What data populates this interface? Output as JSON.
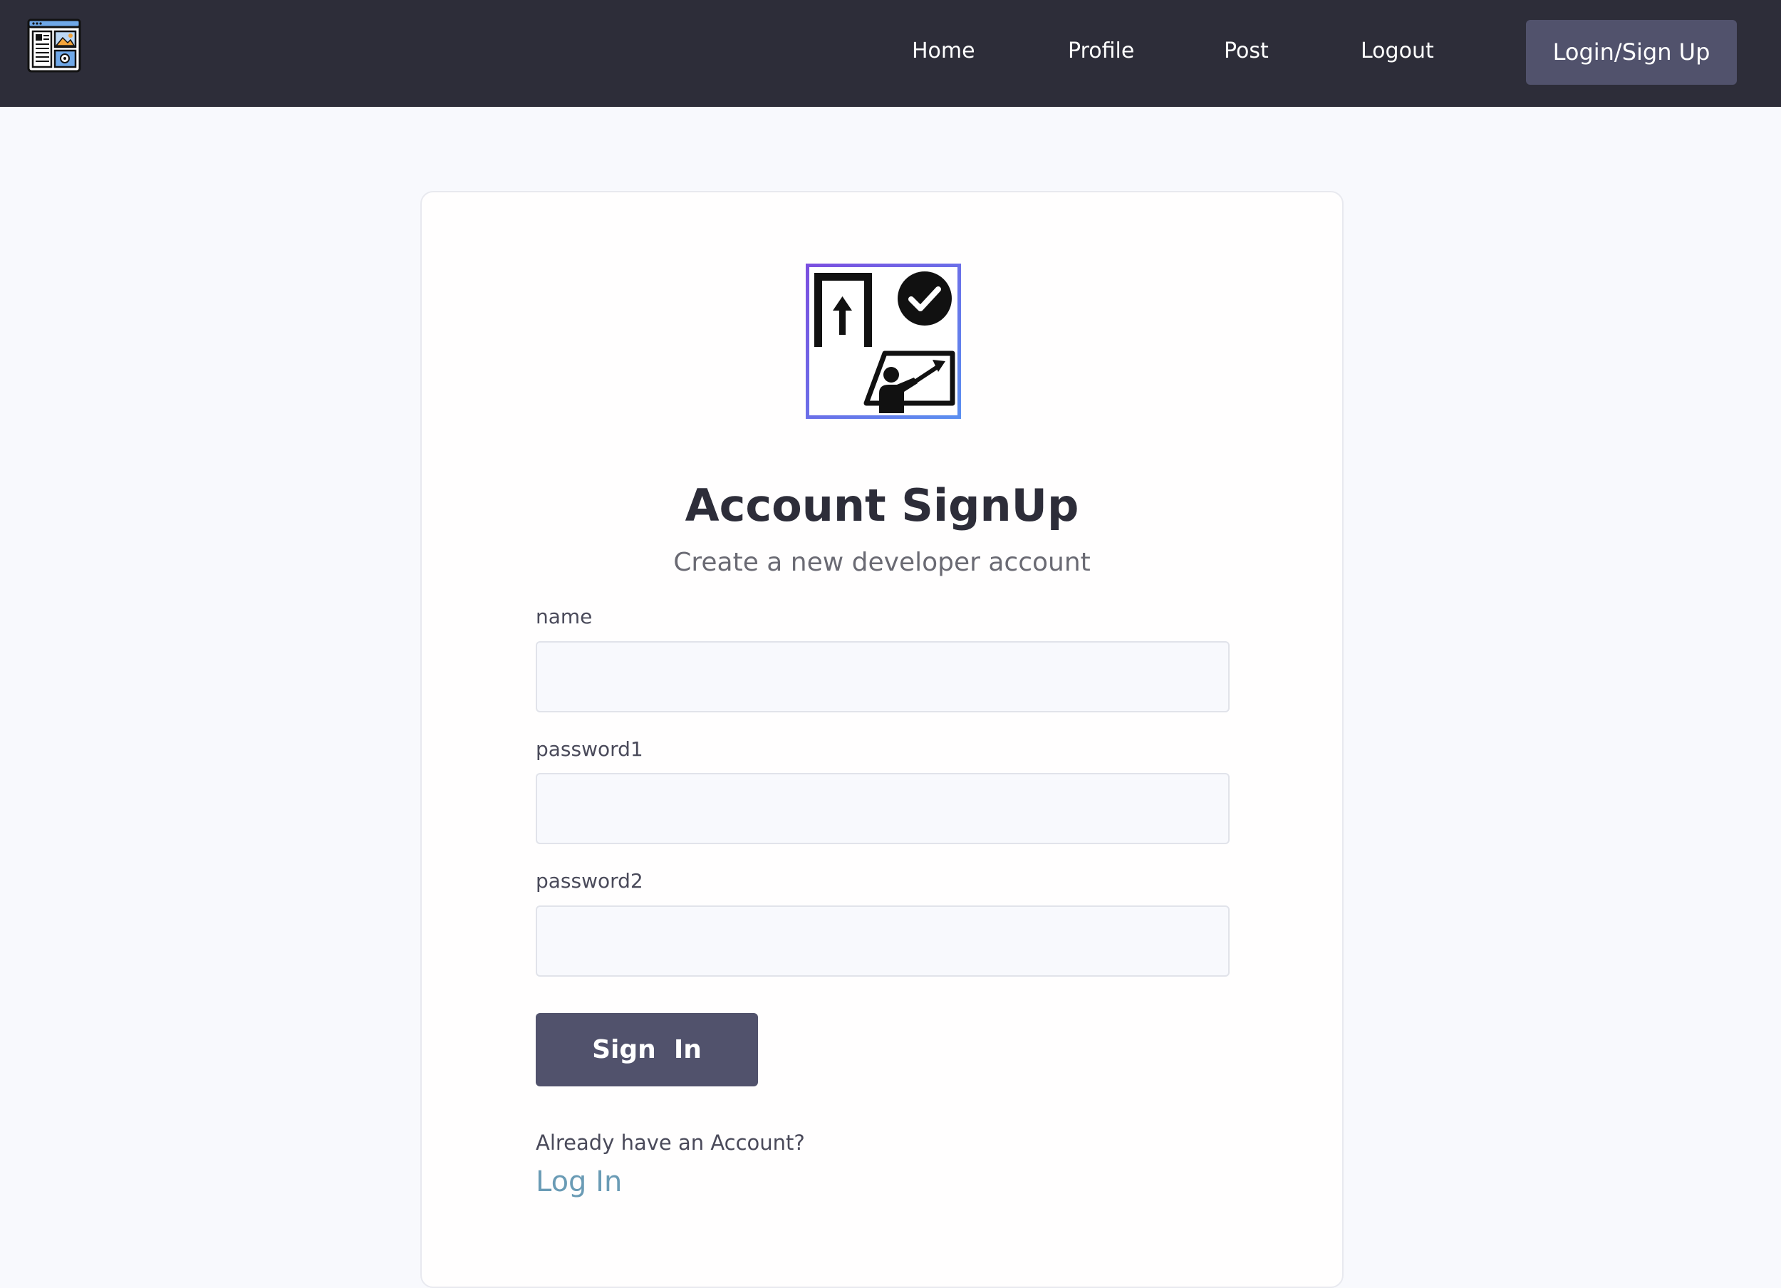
{
  "navbar": {
    "logo_icon": "newspaper-layout-icon",
    "links": [
      {
        "label": "Home"
      },
      {
        "label": "Profile"
      },
      {
        "label": "Post"
      },
      {
        "label": "Logout"
      }
    ],
    "cta_label": "Login/Sign Up"
  },
  "card": {
    "hero_icon": "signup-presentation-check-icon",
    "title": "Account SignUp",
    "subtitle": "Create a new developer account",
    "fields": [
      {
        "label": "name",
        "value": ""
      },
      {
        "label": "password1",
        "value": ""
      },
      {
        "label": "password2",
        "value": ""
      }
    ],
    "submit_label": "Sign  In",
    "already_text": "Already have an Account?",
    "login_link_label": "Log In"
  },
  "colors": {
    "navbar_bg": "#2d2d39",
    "button_bg": "#51526c",
    "page_bg": "#f8f9fd",
    "link": "#6a9bb5",
    "icon_frame_gradient_start": "#7b4fe0",
    "icon_frame_gradient_end": "#5b8ff0"
  }
}
